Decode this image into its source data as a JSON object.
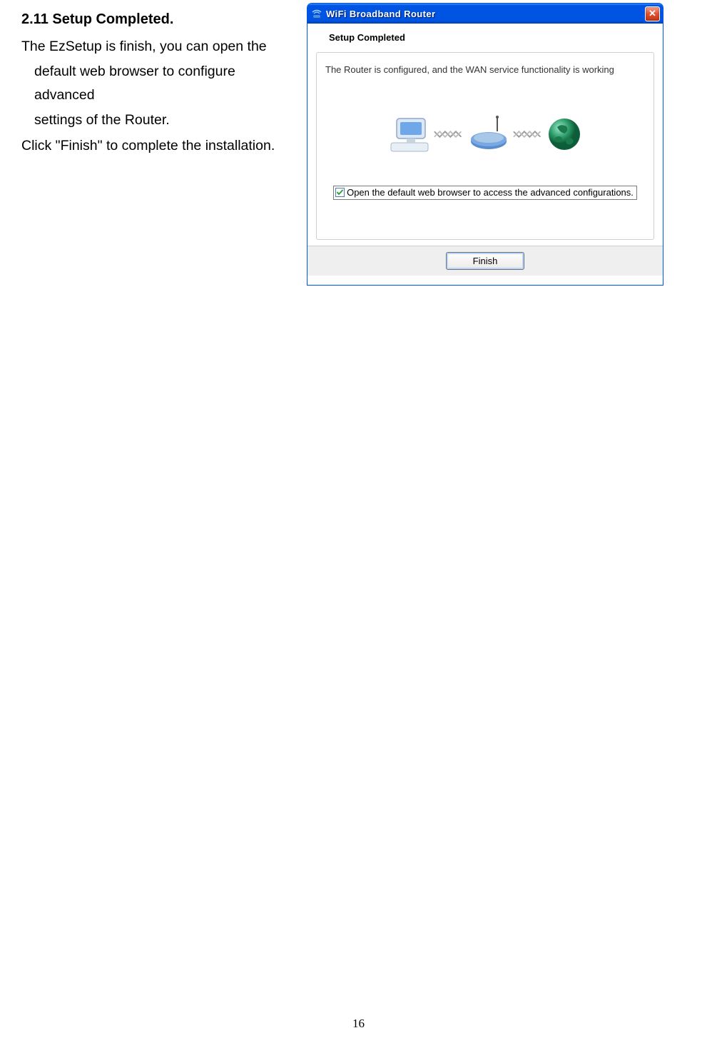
{
  "doc": {
    "section_heading": "2.11 Setup Completed.",
    "para1a": "The EzSetup is finish, you can open the",
    "para1b": "default web browser to configure advanced",
    "para1c": "settings of the Router.",
    "para2": "Click \"Finish\" to complete the installation."
  },
  "window": {
    "title": "WiFi Broadband Router",
    "close": "✕",
    "header": "Setup Completed",
    "status": "The Router is configured, and the WAN service functionality is working",
    "checkbox_label": "Open the default web browser to access the advanced configurations.",
    "finish_button": "Finish"
  },
  "page_number": "16",
  "icons": {
    "app": "wifi-router-icon",
    "computer": "computer-icon",
    "router": "router-icon",
    "globe": "globe-icon",
    "close": "close-icon",
    "checkmark": "checkmark-icon"
  }
}
